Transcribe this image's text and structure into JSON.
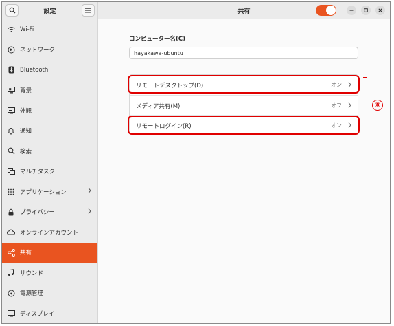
{
  "sidebar": {
    "title": "設定",
    "items": [
      {
        "label": "Wi-Fi",
        "icon": "wifi-icon",
        "chevron": false,
        "active": false
      },
      {
        "label": "ネットワーク",
        "icon": "network-icon",
        "chevron": false,
        "active": false
      },
      {
        "label": "Bluetooth",
        "icon": "bluetooth-icon",
        "chevron": false,
        "active": false
      },
      {
        "label": "背景",
        "icon": "background-icon",
        "chevron": false,
        "active": false
      },
      {
        "label": "外観",
        "icon": "appearance-icon",
        "chevron": false,
        "active": false
      },
      {
        "label": "通知",
        "icon": "bell-icon",
        "chevron": false,
        "active": false
      },
      {
        "label": "検索",
        "icon": "search-icon",
        "chevron": false,
        "active": false
      },
      {
        "label": "マルチタスク",
        "icon": "multitask-icon",
        "chevron": false,
        "active": false
      },
      {
        "label": "アプリケーション",
        "icon": "apps-grid-icon",
        "chevron": true,
        "active": false
      },
      {
        "label": "プライバシー",
        "icon": "lock-icon",
        "chevron": true,
        "active": false
      },
      {
        "label": "オンラインアカウント",
        "icon": "cloud-icon",
        "chevron": false,
        "active": false
      },
      {
        "label": "共有",
        "icon": "share-icon",
        "chevron": false,
        "active": true
      },
      {
        "label": "サウンド",
        "icon": "music-note-icon",
        "chevron": false,
        "active": false
      },
      {
        "label": "電源管理",
        "icon": "power-icon",
        "chevron": false,
        "active": false
      },
      {
        "label": "ディスプレイ",
        "icon": "display-icon",
        "chevron": false,
        "active": false
      }
    ]
  },
  "header": {
    "title": "共有",
    "sharing_enabled": true
  },
  "main": {
    "computer_name_label": "コンピューター名(C)",
    "computer_name_value": "hayakawa-ubuntu",
    "rows": [
      {
        "label": "リモートデスクトップ(D)",
        "value": "オン",
        "highlighted": true
      },
      {
        "label": "メディア共有(M)",
        "value": "オフ",
        "highlighted": false
      },
      {
        "label": "リモートログイン(R)",
        "value": "オン",
        "highlighted": true
      }
    ]
  },
  "annotation": {
    "marker": "⑧"
  },
  "colors": {
    "accent": "#e95420",
    "highlight": "#e00000"
  }
}
